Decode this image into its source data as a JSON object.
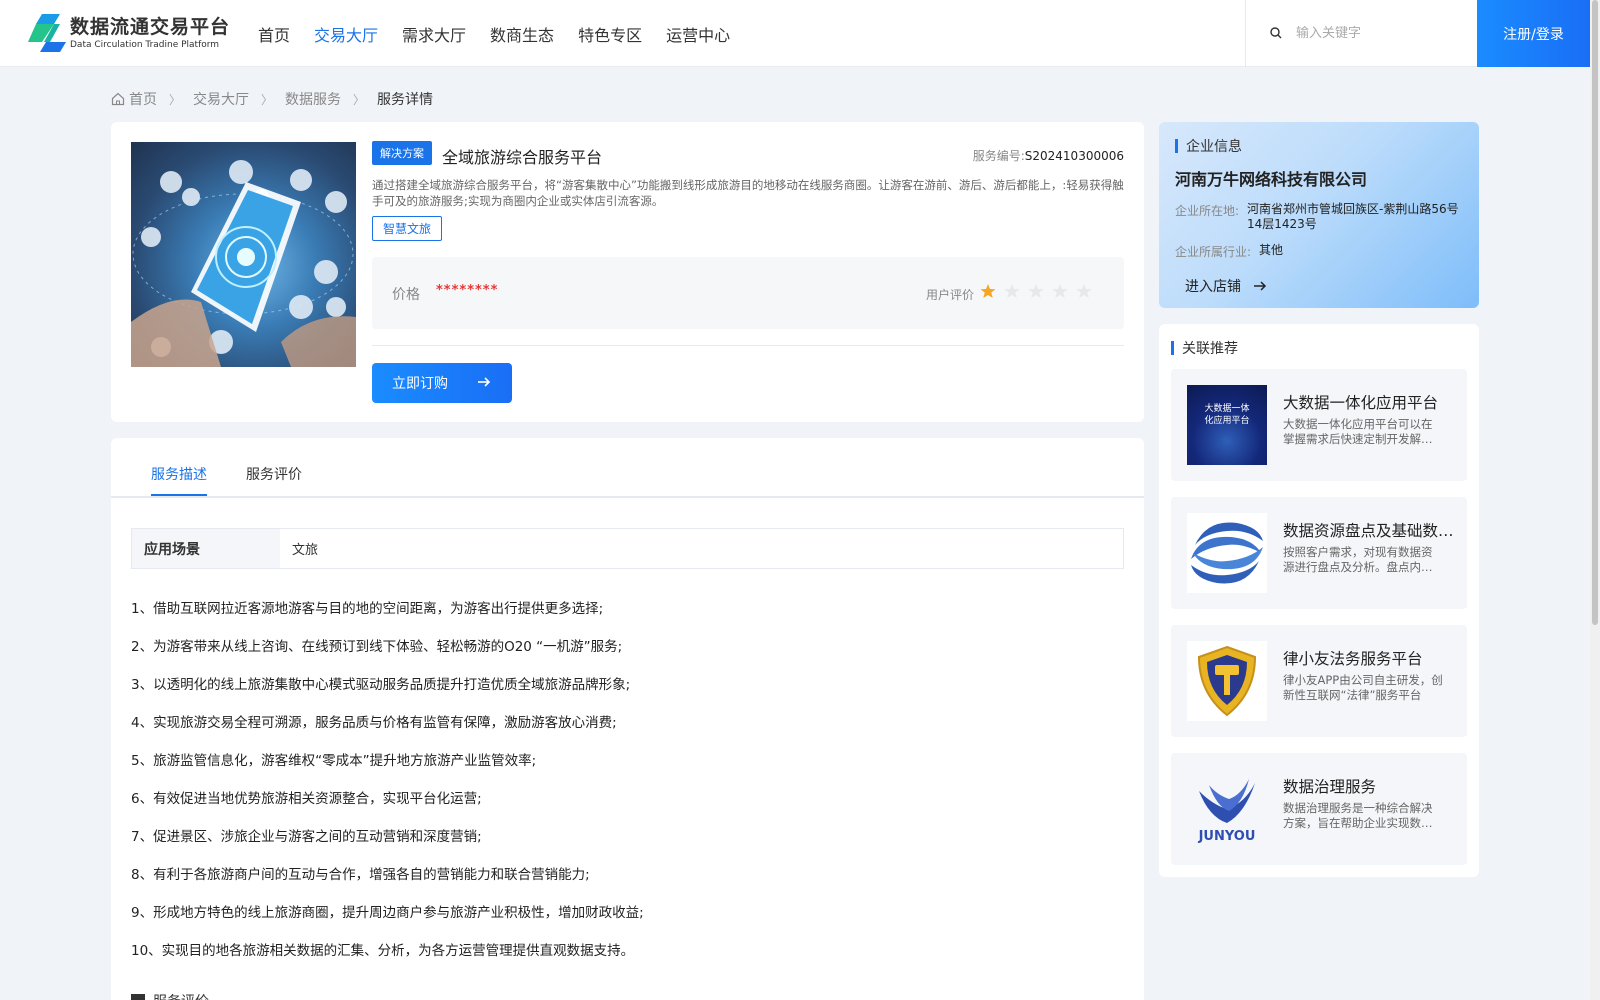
{
  "header": {
    "logo_title": "数据流通交易平台",
    "logo_sub": "Data Circulation Tradine Platform",
    "nav": [
      "首页",
      "交易大厅",
      "需求大厅",
      "数商生态",
      "特色专区",
      "运营中心"
    ],
    "active_nav_index": 1,
    "search_placeholder": "输入关键字",
    "login_label": "注册/登录"
  },
  "breadcrumb": {
    "items": [
      "首页",
      "交易大厅",
      "数据服务",
      "服务详情"
    ]
  },
  "product": {
    "tag": "解决方案",
    "title": "全域旅游综合服务平台",
    "service_no_label": "服务编号:",
    "service_no": "S202410300006",
    "description": "通过搭建全域旅游综合服务平台，将“游客集散中心”功能搬到线形成旅游目的地移动在线服务商圈。让游客在游前、游后、游后都能上，:轻易获得触手可及的旅游服务;实现为商圈内企业或实体店引流客源。",
    "category_tag": "智慧文旅",
    "price_label": "价格",
    "price_value": "********",
    "rating_label": "用户评价",
    "rating": 1,
    "rating_max": 5,
    "order_label": "立即订购"
  },
  "detail": {
    "tabs": [
      "服务描述",
      "服务评价"
    ],
    "active_tab_index": 0,
    "scene_label": "应用场景",
    "scene_value": "文旅",
    "items": [
      "1、借助互联网拉近客源地游客与目的地的空间距离，为游客出行提供更多选择;",
      "2、为游客带来从线上咨询、在线预订到线下体验、轻松畅游的O20 “一机游”服务;",
      "3、以透明化的线上旅游集散中心模式驱动服务品质提升打造优质全域旅游品牌形象;",
      "4、实现旅游交易全程可溯源，服务品质与价格有监管有保障，激励游客放心消费;",
      "5、旅游监管信息化，游客维权“零成本”提升地方旅游产业监管效率;",
      "6、有效促进当地优势旅游相关资源整合，实现平台化运营;",
      "7、促进景区、涉旅企业与游客之间的互动营销和深度营销;",
      "8、有利于各旅游商户间的互动与合作，增强各自的营销能力和联合营销能力;",
      "9、形成地方特色的线上旅游商圈，提升周边商户参与旅游产业积极性，增加财政收益;",
      "10、实现目的地各旅游相关数据的汇集、分析，为各方运营管理提供直观数据支持。"
    ],
    "sub_title": "服务评价"
  },
  "company": {
    "section_title": "企业信息",
    "name": "河南万牛网络科技有限公司",
    "location_label": "企业所在地:",
    "location": "河南省郑州市管城回族区-紫荆山路56号14层1423号",
    "industry_label": "企业所属行业:",
    "industry": "其他",
    "shop_label": "进入店铺"
  },
  "recommend": {
    "section_title": "关联推荐",
    "items": [
      {
        "title": "大数据一体化应用平台",
        "desc": "大数据一体化应用平台可以在掌握需求后快速定制开发解决方案",
        "thumb_text": "大数据一体化应用平台"
      },
      {
        "title": "数据资源盘点及基础数据治理",
        "desc": "按照客户需求，对现有数据资源进行盘点及分析。盘点内容：数据",
        "thumb_text": ""
      },
      {
        "title": "律小友法务服务平台",
        "desc": "律小友APP由公司自主研发，创新性互联网“法律”服务平台",
        "thumb_text": ""
      },
      {
        "title": "数据治理服务",
        "desc": "数据治理服务是一种综合解决方案，旨在帮助企业实现数据价值",
        "thumb_text": "JUNYOU"
      }
    ]
  },
  "colors": {
    "accent": "#1a73e8",
    "price": "#e53935",
    "star_active": "#f5a623",
    "star_inactive": "#e8e8e8"
  }
}
